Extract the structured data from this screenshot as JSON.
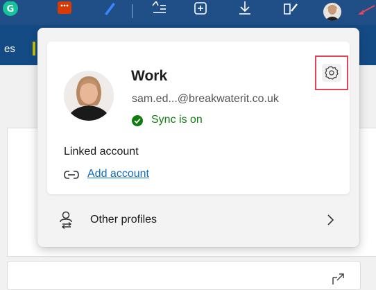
{
  "toolbar": {
    "icons": [
      "grammarly-icon",
      "office-icon",
      "pen-icon",
      "favorites-icon",
      "collections-icon",
      "downloads-icon",
      "performance-icon",
      "profile-avatar-icon"
    ]
  },
  "subbar": {
    "partial_text": "es"
  },
  "profile": {
    "name": "Work",
    "email": "sam.ed...@breakwaterit.co.uk",
    "sync_status": "Sync is on",
    "linked_account_label": "Linked account",
    "add_account_label": "Add account",
    "other_profiles_label": "Other profiles"
  },
  "colors": {
    "toolbar_bg": "#1f4f86",
    "sync_green": "#107c10",
    "link_blue": "#0f6cbd",
    "highlight_red": "#e0455a"
  }
}
